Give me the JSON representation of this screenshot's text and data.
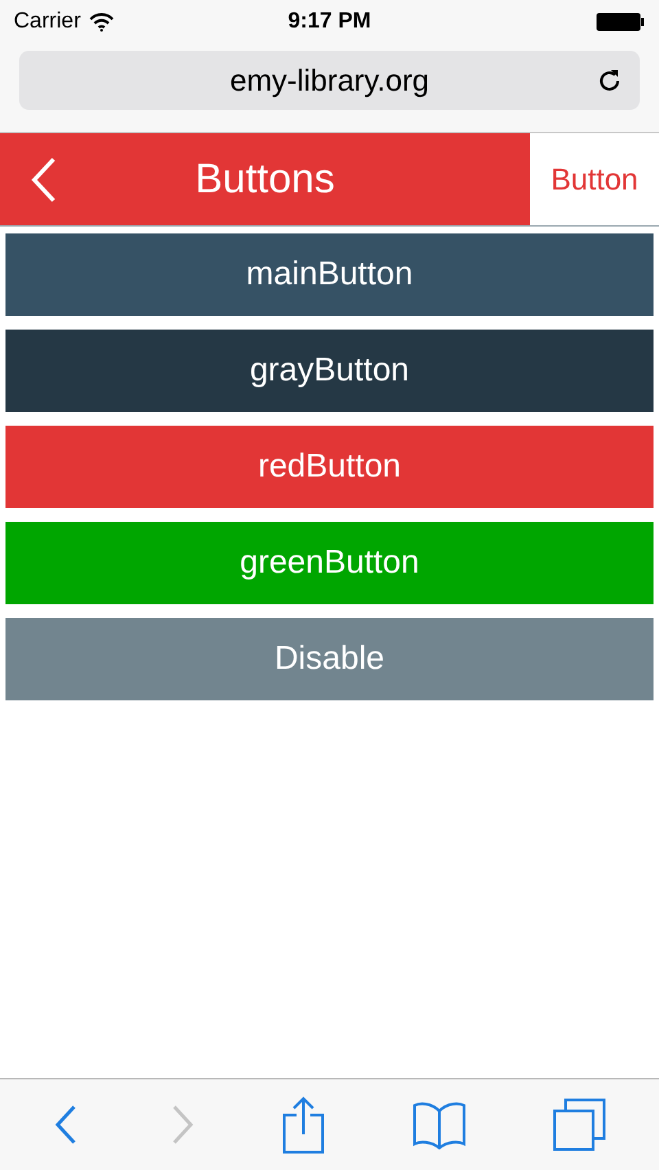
{
  "status_bar": {
    "carrier": "Carrier",
    "time": "9:17 PM"
  },
  "address_bar": {
    "url": "emy-library.org"
  },
  "header": {
    "title": "Buttons",
    "action": "Button"
  },
  "buttons": [
    {
      "label": "mainButton",
      "kind": "main"
    },
    {
      "label": "grayButton",
      "kind": "gray"
    },
    {
      "label": "redButton",
      "kind": "red"
    },
    {
      "label": "greenButton",
      "kind": "green"
    },
    {
      "label": "Disable",
      "kind": "disabled"
    }
  ],
  "toolbar": {
    "back_disabled": false,
    "forward_disabled": true
  }
}
